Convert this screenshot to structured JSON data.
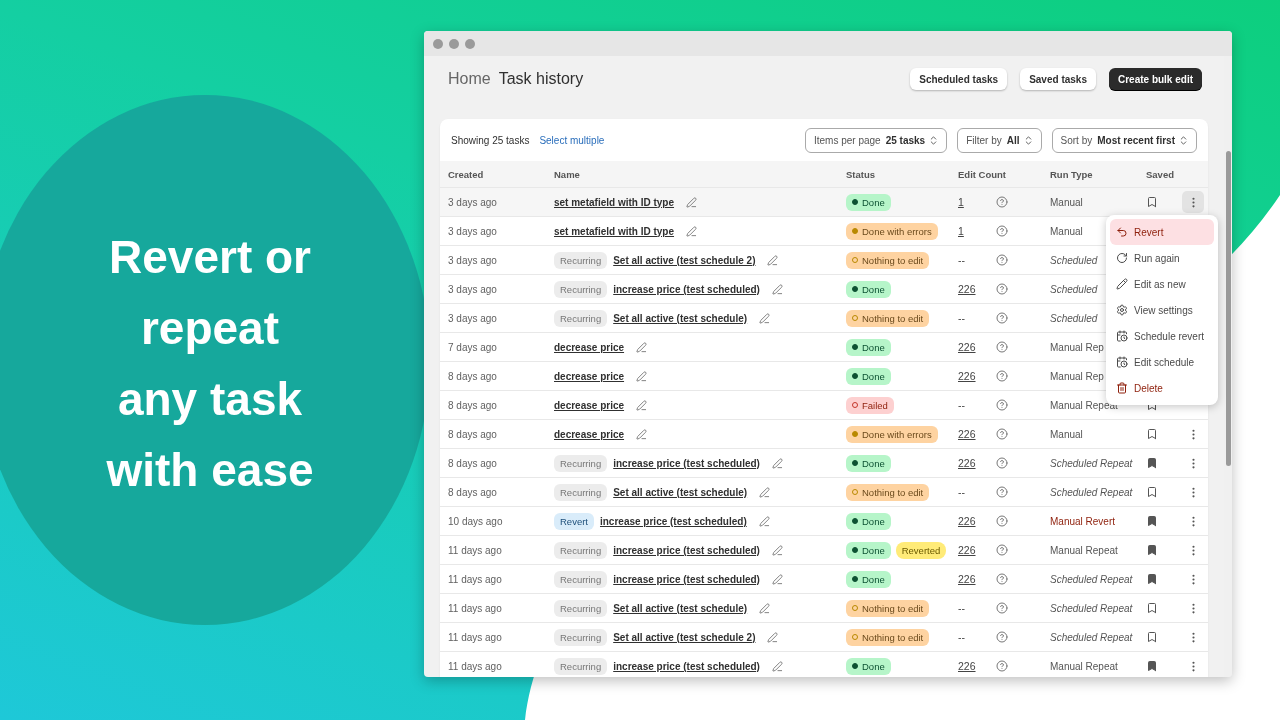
{
  "headline": "Revert or\nrepeat\nany task\nwith ease",
  "breadcrumb": {
    "home": "Home",
    "current": "Task history"
  },
  "header_buttons": [
    {
      "label": "Scheduled tasks",
      "primary": false
    },
    {
      "label": "Saved tasks",
      "primary": false
    },
    {
      "label": "Create bulk edit",
      "primary": true
    }
  ],
  "toolbar": {
    "count": "Showing 25 tasks",
    "select_link": "Select multiple",
    "selects": [
      {
        "label": "Items per page",
        "value": "25 tasks"
      },
      {
        "label": "Filter by",
        "value": "All"
      },
      {
        "label": "Sort by",
        "value": "Most recent first"
      }
    ]
  },
  "columns": [
    "Created",
    "Name",
    "Status",
    "Edit Count",
    "Run Type",
    "Saved"
  ],
  "rows": [
    {
      "created": "3 days ago",
      "tag": null,
      "name": "set metafield with ID type",
      "status": {
        "kind": "done",
        "label": "Done"
      },
      "reverted": null,
      "count": "1",
      "linked": true,
      "run_type": {
        "kind": "manual",
        "label": "Manual"
      },
      "saved": false,
      "menu_open": true
    },
    {
      "created": "3 days ago",
      "tag": null,
      "name": "set metafield with ID type",
      "status": {
        "kind": "errors",
        "label": "Done with errors"
      },
      "reverted": null,
      "count": "1",
      "linked": true,
      "run_type": {
        "kind": "manual",
        "label": "Manual"
      }
    },
    {
      "created": "3 days ago",
      "tag": {
        "kind": "recurring",
        "label": "Recurring"
      },
      "name": "Set all active (test schedule 2)",
      "status": {
        "kind": "nothing",
        "label": "Nothing to edit"
      },
      "reverted": null,
      "count": "--",
      "linked": false,
      "run_type": {
        "kind": "scheduled",
        "label": "Scheduled"
      }
    },
    {
      "created": "3 days ago",
      "tag": {
        "kind": "recurring",
        "label": "Recurring"
      },
      "name": "increase price (test scheduled)",
      "status": {
        "kind": "done",
        "label": "Done"
      },
      "reverted": null,
      "count": "226",
      "linked": true,
      "run_type": {
        "kind": "scheduled",
        "label": "Scheduled"
      }
    },
    {
      "created": "3 days ago",
      "tag": {
        "kind": "recurring",
        "label": "Recurring"
      },
      "name": "Set all active (test schedule)",
      "status": {
        "kind": "nothing",
        "label": "Nothing to edit"
      },
      "reverted": null,
      "count": "--",
      "linked": false,
      "run_type": {
        "kind": "scheduled",
        "label": "Scheduled"
      }
    },
    {
      "created": "7 days ago",
      "tag": null,
      "name": "decrease price",
      "status": {
        "kind": "done",
        "label": "Done"
      },
      "reverted": null,
      "count": "226",
      "linked": true,
      "run_type": {
        "kind": "manual",
        "label": "Manual Rep"
      }
    },
    {
      "created": "8 days ago",
      "tag": null,
      "name": "decrease price",
      "status": {
        "kind": "done",
        "label": "Done"
      },
      "reverted": null,
      "count": "226",
      "linked": true,
      "run_type": {
        "kind": "manual",
        "label": "Manual Rep"
      }
    },
    {
      "created": "8 days ago",
      "tag": null,
      "name": "decrease price",
      "status": {
        "kind": "failed",
        "label": "Failed"
      },
      "reverted": null,
      "count": "--",
      "linked": false,
      "run_type": {
        "kind": "manual",
        "label": "Manual Repeat"
      },
      "saved": false
    },
    {
      "created": "8 days ago",
      "tag": null,
      "name": "decrease price",
      "status": {
        "kind": "errors",
        "label": "Done with errors"
      },
      "reverted": null,
      "count": "226",
      "linked": true,
      "run_type": {
        "kind": "manual",
        "label": "Manual"
      },
      "saved": false,
      "menu_open": false
    },
    {
      "created": "8 days ago",
      "tag": {
        "kind": "recurring",
        "label": "Recurring"
      },
      "name": "increase price (test scheduled)",
      "status": {
        "kind": "done",
        "label": "Done"
      },
      "reverted": null,
      "count": "226",
      "linked": true,
      "run_type": {
        "kind": "scheduled",
        "label": "Scheduled Repeat"
      },
      "saved": true,
      "menu_open": false
    },
    {
      "created": "8 days ago",
      "tag": {
        "kind": "recurring",
        "label": "Recurring"
      },
      "name": "Set all active (test schedule)",
      "status": {
        "kind": "nothing",
        "label": "Nothing to edit"
      },
      "reverted": null,
      "count": "--",
      "linked": false,
      "run_type": {
        "kind": "scheduled",
        "label": "Scheduled Repeat"
      },
      "saved": false,
      "menu_open": false
    },
    {
      "created": "10 days ago",
      "tag": {
        "kind": "revert",
        "label": "Revert"
      },
      "name": "increase price (test scheduled)",
      "status": {
        "kind": "done",
        "label": "Done"
      },
      "reverted": null,
      "count": "226",
      "linked": true,
      "run_type": {
        "kind": "revert",
        "label": "Manual Revert"
      },
      "saved": true,
      "menu_open": false
    },
    {
      "created": "11 days ago",
      "tag": {
        "kind": "recurring",
        "label": "Recurring"
      },
      "name": "increase price (test scheduled)",
      "status": {
        "kind": "done",
        "label": "Done"
      },
      "reverted": "Reverted",
      "count": "226",
      "linked": true,
      "run_type": {
        "kind": "manual",
        "label": "Manual Repeat"
      },
      "saved": true,
      "menu_open": false
    },
    {
      "created": "11 days ago",
      "tag": {
        "kind": "recurring",
        "label": "Recurring"
      },
      "name": "increase price (test scheduled)",
      "status": {
        "kind": "done",
        "label": "Done"
      },
      "reverted": null,
      "count": "226",
      "linked": true,
      "run_type": {
        "kind": "scheduled",
        "label": "Scheduled Repeat"
      },
      "saved": true,
      "menu_open": false
    },
    {
      "created": "11 days ago",
      "tag": {
        "kind": "recurring",
        "label": "Recurring"
      },
      "name": "Set all active (test schedule)",
      "status": {
        "kind": "nothing",
        "label": "Nothing to edit"
      },
      "reverted": null,
      "count": "--",
      "linked": false,
      "run_type": {
        "kind": "scheduled",
        "label": "Scheduled Repeat"
      },
      "saved": false,
      "menu_open": false
    },
    {
      "created": "11 days ago",
      "tag": {
        "kind": "recurring",
        "label": "Recurring"
      },
      "name": "Set all active (test schedule 2)",
      "status": {
        "kind": "nothing",
        "label": "Nothing to edit"
      },
      "reverted": null,
      "count": "--",
      "linked": false,
      "run_type": {
        "kind": "scheduled",
        "label": "Scheduled Repeat"
      },
      "saved": false,
      "menu_open": false
    },
    {
      "created": "11 days ago",
      "tag": {
        "kind": "recurring",
        "label": "Recurring"
      },
      "name": "increase price (test scheduled)",
      "status": {
        "kind": "done",
        "label": "Done"
      },
      "reverted": null,
      "count": "226",
      "linked": true,
      "run_type": {
        "kind": "manual",
        "label": "Manual Repeat"
      },
      "saved": true,
      "menu_open": false
    }
  ],
  "menu": [
    {
      "kind": "revert",
      "label": "Revert",
      "selected": true,
      "destructive": true
    },
    {
      "kind": "run",
      "label": "Run again",
      "selected": false,
      "destructive": false
    },
    {
      "kind": "edit",
      "label": "Edit as new",
      "selected": false,
      "destructive": false
    },
    {
      "kind": "settings",
      "label": "View settings",
      "selected": false,
      "destructive": false
    },
    {
      "kind": "schedule",
      "label": "Schedule revert",
      "selected": false,
      "destructive": false
    },
    {
      "kind": "schedule",
      "label": "Edit schedule",
      "selected": false,
      "destructive": false
    },
    {
      "kind": "delete",
      "label": "Delete",
      "selected": false,
      "destructive": true
    }
  ]
}
